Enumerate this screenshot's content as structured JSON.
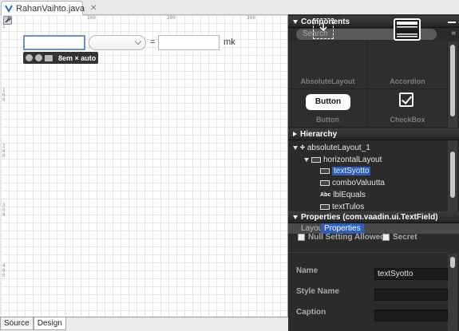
{
  "editor": {
    "tab_title": "RahanVaihto.java"
  },
  "canvas": {
    "equals": "=",
    "unit": "mk",
    "size_label": "8em × auto",
    "ruler_top": [
      "1",
      "100",
      "200",
      "300"
    ],
    "ruler_side": [
      "1",
      "100",
      "200",
      "300",
      "400"
    ]
  },
  "bottom_tabs": [
    "Source",
    "Design"
  ],
  "components": {
    "title": "Components",
    "search_placeholder": "Search",
    "items": [
      "AbsoluteLayout",
      "Accordion",
      "Button",
      "CheckBox"
    ],
    "button_preview": "Button"
  },
  "hierarchy": {
    "title": "Hierarchy",
    "nodes": [
      "absoluteLayout_1",
      "horizontalLayout",
      "textSyotto",
      "comboValuutta",
      "lblEquals",
      "textTulos"
    ]
  },
  "properties": {
    "title": "Properties (com.vaadin.ui.TextField)",
    "tabs": [
      "Layout",
      "Properties"
    ],
    "checkboxes": [
      "Null Setting Allowed",
      "Secret"
    ],
    "fields": [
      {
        "label": "Name",
        "value": "textSyotto"
      },
      {
        "label": "Style Name",
        "value": ""
      },
      {
        "label": "Caption",
        "value": ""
      }
    ]
  }
}
